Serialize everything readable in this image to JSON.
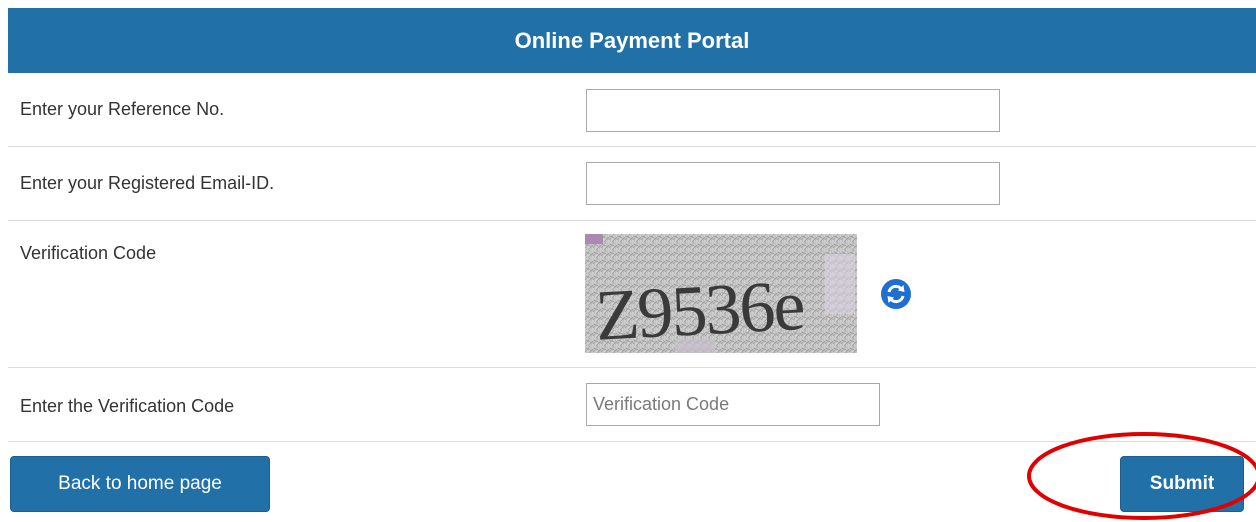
{
  "header": {
    "title": "Online Payment Portal"
  },
  "form": {
    "reference_label": "Enter your Reference No.",
    "reference_value": "",
    "email_label": "Enter your Registered Email-ID.",
    "email_value": "",
    "verification_label": "Verification Code",
    "captcha_text": "Z9536e",
    "enter_code_label": "Enter the Verification Code",
    "enter_code_placeholder": "Verification Code",
    "enter_code_value": ""
  },
  "icons": {
    "refresh": "refresh-icon"
  },
  "buttons": {
    "back_label": "Back to home page",
    "submit_label": "Submit"
  },
  "colors": {
    "brand": "#2270a8",
    "highlight": "#e00000"
  }
}
